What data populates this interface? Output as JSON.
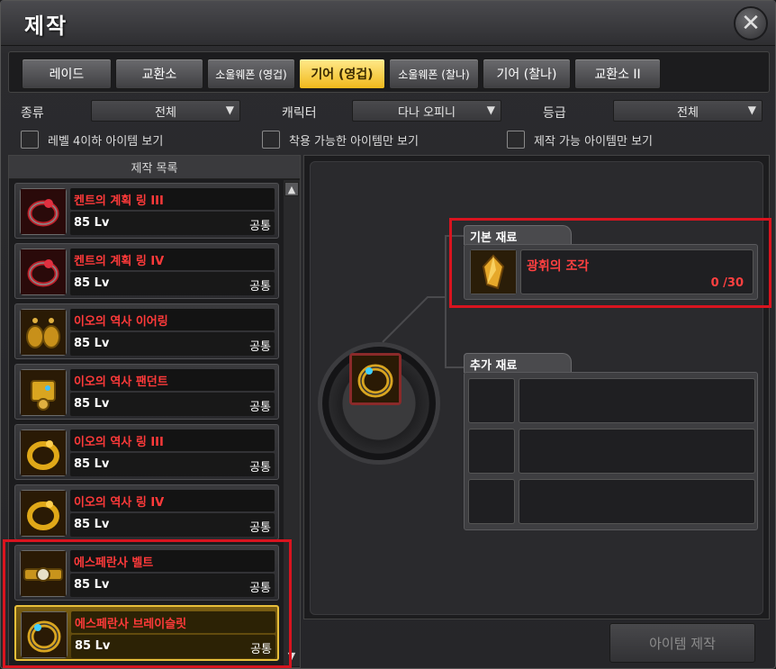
{
  "window": {
    "title": "제작"
  },
  "tabs": [
    {
      "label": "레이드",
      "active": false
    },
    {
      "label": "교환소",
      "active": false
    },
    {
      "label": "소울웨폰 (영겁)",
      "active": false
    },
    {
      "label": "기어 (영겁)",
      "active": true
    },
    {
      "label": "소울웨폰 (찰나)",
      "active": false
    },
    {
      "label": "기어 (찰나)",
      "active": false
    },
    {
      "label": "교환소 II",
      "active": false
    }
  ],
  "filters": {
    "type_label": "종류",
    "type_value": "전체",
    "character_label": "캐릭터",
    "character_value": "다나 오피니",
    "grade_label": "등급",
    "grade_value": "전체"
  },
  "checks": {
    "level_below": "레벨 4이하 아이템 보기",
    "equippable": "착용 가능한 아이템만 보기",
    "craftable": "제작 가능 아이템만 보기"
  },
  "list": {
    "header": "제작 목록",
    "items": [
      {
        "name": "켄트의 계획 링 III",
        "level": "85  Lv",
        "class": "공통",
        "icon": "red-ring-icon"
      },
      {
        "name": "켄트의 계획 링 IV",
        "level": "85  Lv",
        "class": "공통",
        "icon": "red-ring-icon"
      },
      {
        "name": "이오의 역사 이어링",
        "level": "85  Lv",
        "class": "공통",
        "icon": "gold-earring-icon"
      },
      {
        "name": "이오의 역사 팬던트",
        "level": "85  Lv",
        "class": "공통",
        "icon": "gold-pendant-icon"
      },
      {
        "name": "이오의 역사 링 III",
        "level": "85  Lv",
        "class": "공통",
        "icon": "gold-ring-icon"
      },
      {
        "name": "이오의 역사 링 IV",
        "level": "85  Lv",
        "class": "공통",
        "icon": "gold-ring-icon"
      },
      {
        "name": "에스페란사 벨트",
        "level": "85  Lv",
        "class": "공통",
        "icon": "belt-icon"
      },
      {
        "name": "에스페란사 브레이슬릿",
        "level": "85  Lv",
        "class": "공통",
        "icon": "bracelet-icon",
        "selected": true
      }
    ]
  },
  "materials": {
    "basic_title": "기본 재료",
    "basic_name": "광휘의 조각",
    "basic_count": "0 /30",
    "extra_title": "추가 재료"
  },
  "craft_button": "아이템 제작",
  "colors": {
    "accent": "#f1b91c",
    "highlight": "#d9141f",
    "item_name": "#ff3a3a"
  }
}
